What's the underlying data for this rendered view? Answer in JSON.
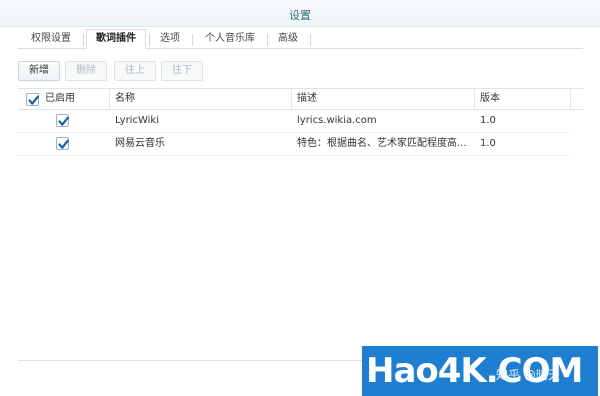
{
  "window": {
    "title": "设置"
  },
  "tabs": [
    {
      "label": "权限设置",
      "active": false
    },
    {
      "label": "歌词插件",
      "active": true
    },
    {
      "label": "选项",
      "active": false
    },
    {
      "label": "个人音乐库",
      "active": false
    },
    {
      "label": "高级",
      "active": false
    }
  ],
  "toolbar": {
    "add_label": "新增",
    "delete_label": "删除",
    "up_label": "往上",
    "down_label": "往下"
  },
  "table": {
    "columns": [
      "已启用",
      "名称",
      "描述",
      "版本"
    ],
    "rows": [
      {
        "enabled": true,
        "name": "LyricWiki",
        "description": "lyrics.wikia.com",
        "version": "1.0"
      },
      {
        "enabled": true,
        "name": "网易云音乐",
        "description": "特色：根据曲名、艺术家匹配程度高...",
        "version": "1.0"
      }
    ]
  },
  "watermark": {
    "logo_text": "Hao4K.COM",
    "overlay_text": "知乎 @晴天"
  },
  "colors": {
    "accent": "#1e7fd0",
    "title": "#3a6a86",
    "checkbox": "#1a5fa0"
  }
}
